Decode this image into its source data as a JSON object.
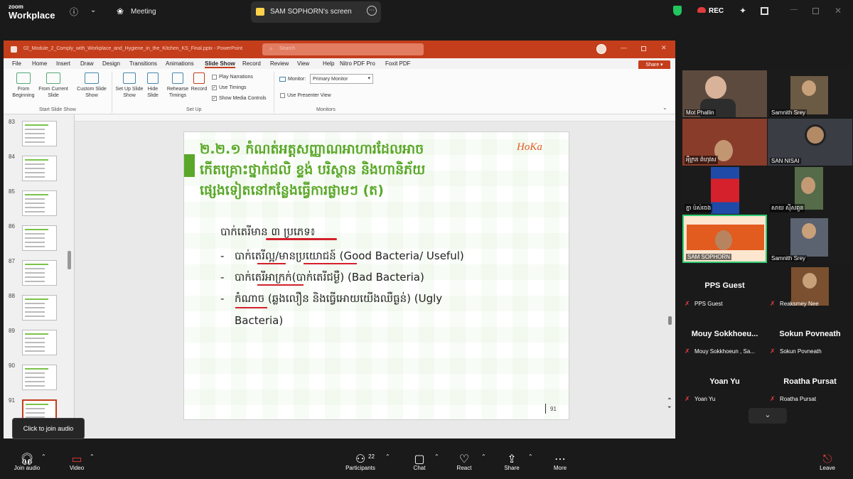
{
  "app": {
    "brand_small": "zoom",
    "brand_big": "Workplace"
  },
  "topbar": {
    "meeting_label": "Meeting",
    "share_tab_label": "SAM SOPHORN's screen",
    "rec_label": "REC"
  },
  "ppt": {
    "file_title": "02_Module_2_Comply_with_Workplace_and_Hygiene_in_the_Kitchen_KS_Final.pptx - PowerPoint",
    "search_placeholder": "Search",
    "share_label": "Share",
    "tabs": [
      "File",
      "Home",
      "Insert",
      "Draw",
      "Design",
      "Transitions",
      "Animations",
      "Slide Show",
      "Record",
      "Review",
      "View",
      "Help",
      "Nitro PDF Pro",
      "Foxit PDF"
    ],
    "active_tab": "Slide Show",
    "ribbon": {
      "from_beginning": "From Beginning",
      "from_current": "From Current Slide",
      "custom_show": "Custom Slide Show",
      "group_start": "Start Slide Show",
      "set_up": "Set Up Slide Show",
      "hide_slide": "Hide Slide",
      "rehearse": "Rehearse Timings",
      "record": "Record",
      "play_narrations": "Play Narrations",
      "use_timings": "Use Timings",
      "show_media": "Show Media Controls",
      "group_setup": "Set Up",
      "monitor_label": "Monitor:",
      "monitor_value": "Primary Monitor",
      "use_presenter": "Use Presenter View",
      "group_monitors": "Monitors"
    },
    "thumb_numbers": [
      "83",
      "84",
      "85",
      "86",
      "87",
      "88",
      "89",
      "90",
      "91"
    ]
  },
  "slide": {
    "title_l1": "២.២.១ កំណត់អត្តសញ្ញាណអាហារដែលអាច",
    "title_l2": "កើតគ្រោះថ្នាក់ជលិ ខ្ទង់ បរិស្ថាន និងហានិភ័យ",
    "title_l3": "ផ្សេងទៀតនៅកន្លែងធ្វើការផ្លាមៗ (ត)",
    "logo": "HoKa",
    "intro": "បាក់តេរីមាន ៣ ប្រភេទ៖",
    "items": [
      {
        "dash": "-",
        "text": "បាក់តេរីល្អ/មានប្រយោជន៍ (Good Bacteria/ Useful)"
      },
      {
        "dash": "-",
        "text": "បាក់តេរីអាក្រក់(បាក់តេរីជម្ងឺ) (Bad Bacteria)"
      },
      {
        "dash": "-",
        "text": "កំណាច (ឆ្លងលឿន និងធ្វើអោយយើងឈឺធ្ងន់) (Ugly"
      }
    ],
    "item3_cont": "Bacteria)",
    "page_num": "91"
  },
  "gallery": {
    "tiles": [
      {
        "name": "Mot Phallin"
      },
      {
        "name": "Samnith Srey"
      },
      {
        "name": "អុឹក្រន ព៌ហុវស"
      },
      {
        "name": "SAN NISAI"
      },
      {
        "name": "ភ្នា ប៉ស់ចេង"
      },
      {
        "name": "សាយ ស៊ីសពួន"
      },
      {
        "name": "SAM SOPHORN"
      },
      {
        "name": "Samnith Srey"
      },
      {
        "big": "PPS Guest",
        "name": "PPS Guest"
      },
      {
        "name": "Reaksmey Nee"
      },
      {
        "big": "Mouy  Sokkhoeu...",
        "name": "Mouy Sokkhoeun , Sa..."
      },
      {
        "big": "Sokun Povneath",
        "name": "Sokun Povneath"
      },
      {
        "big": "Yoan Yu",
        "name": "Yoan Yu"
      },
      {
        "big": "Roatha Pursat",
        "name": "Roatha Pursat"
      }
    ]
  },
  "bottombar": {
    "join_audio": "Join audio",
    "video": "Video",
    "participants": "Participants",
    "participants_count": "22",
    "chat": "Chat",
    "react": "React",
    "share": "Share",
    "more": "More",
    "leave": "Leave",
    "tooltip": "Click to join audio"
  },
  "colors": {
    "ppt_accent": "#c43e1c",
    "slide_green": "#5aa829",
    "zoom_green": "#22c55e",
    "rec_red": "#e03b3b"
  }
}
